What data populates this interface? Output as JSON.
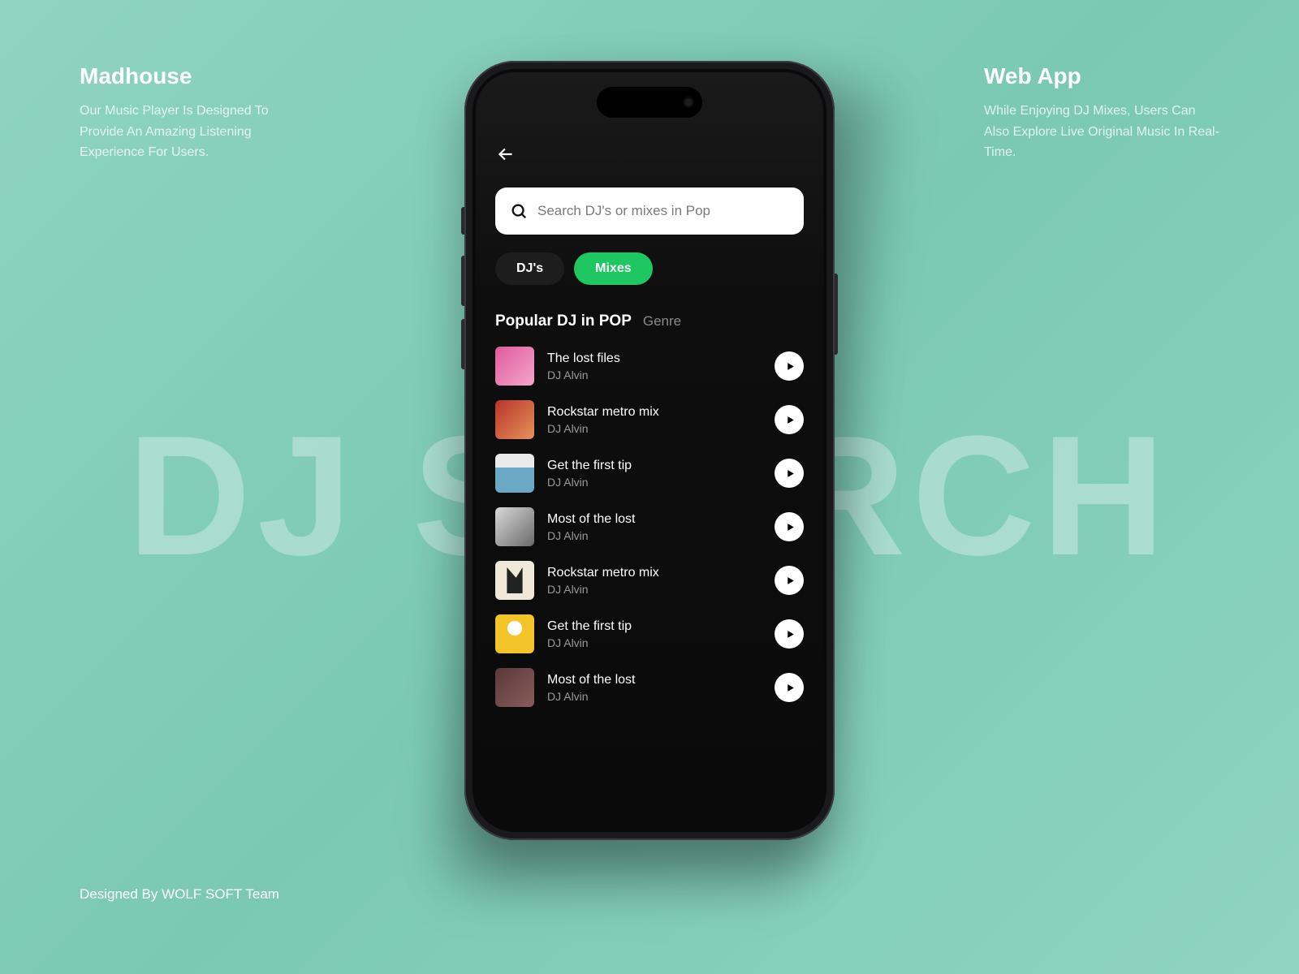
{
  "bg_text": "DJ SEARCH",
  "left": {
    "title": "Madhouse",
    "desc": "Our Music Player Is Designed To Provide An Amazing Listening Experience For Users."
  },
  "right": {
    "title": "Web App",
    "desc": "While Enjoying DJ Mixes, Users Can Also Explore Live Original Music In Real-Time."
  },
  "credit": "Designed By WOLF SOFT Team",
  "search": {
    "placeholder": "Search DJ's or mixes in Pop"
  },
  "tabs": {
    "djs": "DJ's",
    "mixes": "Mixes"
  },
  "section": {
    "title": "Popular DJ in POP",
    "sub": "Genre"
  },
  "tracks": [
    {
      "title": "The lost files",
      "artist": "DJ Alvin"
    },
    {
      "title": "Rockstar metro mix",
      "artist": "DJ Alvin"
    },
    {
      "title": "Get the first tip",
      "artist": "DJ Alvin"
    },
    {
      "title": "Most of the lost",
      "artist": "DJ Alvin"
    },
    {
      "title": "Rockstar metro mix",
      "artist": "DJ Alvin"
    },
    {
      "title": "Get the first tip",
      "artist": "DJ Alvin"
    },
    {
      "title": "Most of the lost",
      "artist": "DJ Alvin"
    }
  ]
}
